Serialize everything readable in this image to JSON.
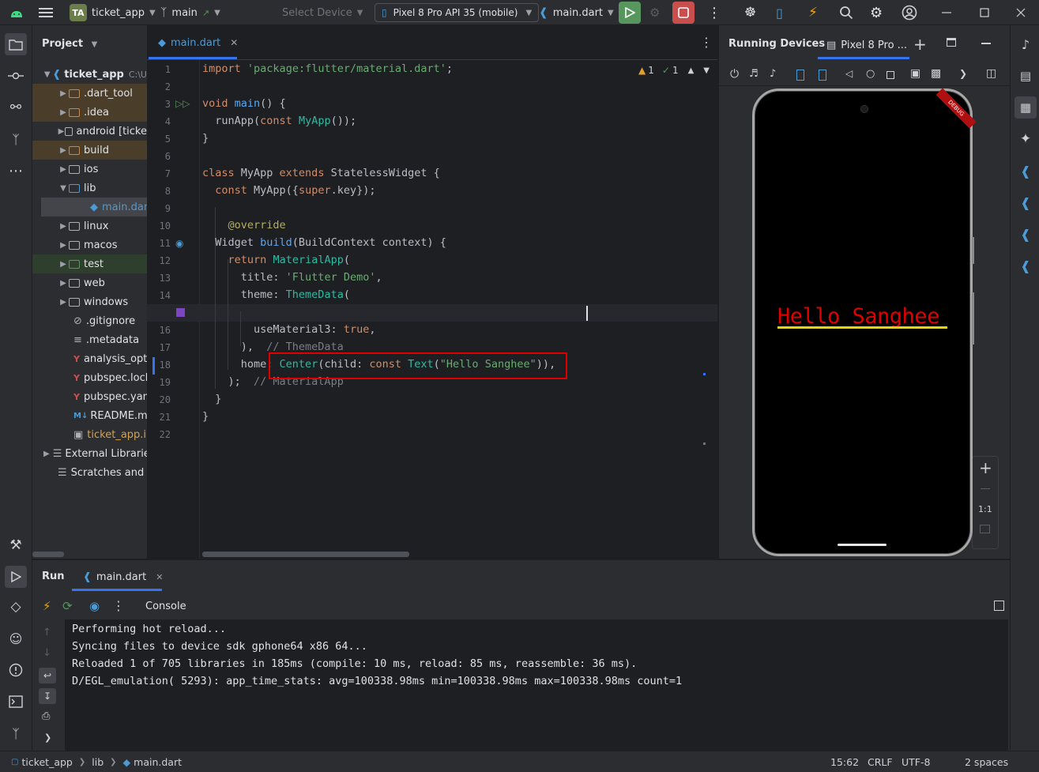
{
  "titlebar": {
    "project_badge": "TA",
    "project_name": "ticket_app",
    "branch": "main",
    "select_device": "Select Device",
    "device": "Pixel 8 Pro API 35 (mobile)",
    "run_config": "main.dart"
  },
  "project_panel": {
    "title": "Project",
    "root": "ticket_app",
    "root_path": "C:\\U",
    "items": [
      {
        "label": ".dart_tool"
      },
      {
        "label": ".idea"
      },
      {
        "label": "android [ticke"
      },
      {
        "label": "build"
      },
      {
        "label": "ios"
      },
      {
        "label": "lib"
      },
      {
        "label": "main.dart"
      },
      {
        "label": "linux"
      },
      {
        "label": "macos"
      },
      {
        "label": "test"
      },
      {
        "label": "web"
      },
      {
        "label": "windows"
      },
      {
        "label": ".gitignore"
      },
      {
        "label": ".metadata"
      },
      {
        "label": "analysis_optio"
      },
      {
        "label": "pubspec.lock"
      },
      {
        "label": "pubspec.yaml"
      },
      {
        "label": "README.md"
      },
      {
        "label": "ticket_app.iml"
      },
      {
        "label": "External Libraries"
      },
      {
        "label": "Scratches and Co"
      }
    ]
  },
  "editor": {
    "tab": "main.dart",
    "warnings": "1",
    "checks": "1",
    "line_numbers": [
      "1",
      "2",
      "3",
      "4",
      "5",
      "6",
      "7",
      "8",
      "9",
      "10",
      "11",
      "12",
      "13",
      "14",
      "15",
      "16",
      "17",
      "18",
      "19",
      "20",
      "21",
      "22"
    ]
  },
  "devices": {
    "title": "Running Devices",
    "tab": "Pixel 8 Pro ...",
    "app_text": "Hello Sanghee",
    "debug_banner": "DEBUG",
    "zoom_reset": "1:1"
  },
  "run_panel": {
    "tab_run": "Run",
    "tab_file": "main.dart",
    "console_label": "Console",
    "lines": [
      "Performing hot reload...",
      "Syncing files to device sdk gphone64 x86 64...",
      "Reloaded 1 of 705 libraries in 185ms (compile: 10 ms, reload: 85 ms, reassemble: 36 ms).",
      "D/EGL_emulation( 5293): app_time_stats: avg=100338.98ms min=100338.98ms max=100338.98ms count=1"
    ]
  },
  "statusbar": {
    "crumb1": "ticket_app",
    "crumb2": "lib",
    "crumb3": "main.dart",
    "position": "15:62",
    "line_sep": "CRLF",
    "encoding": "UTF-8",
    "indent": "2 spaces"
  },
  "colors": {
    "highlight_box": "#e00000",
    "app_text": "#e00000",
    "app_underline": "#e8d800"
  }
}
